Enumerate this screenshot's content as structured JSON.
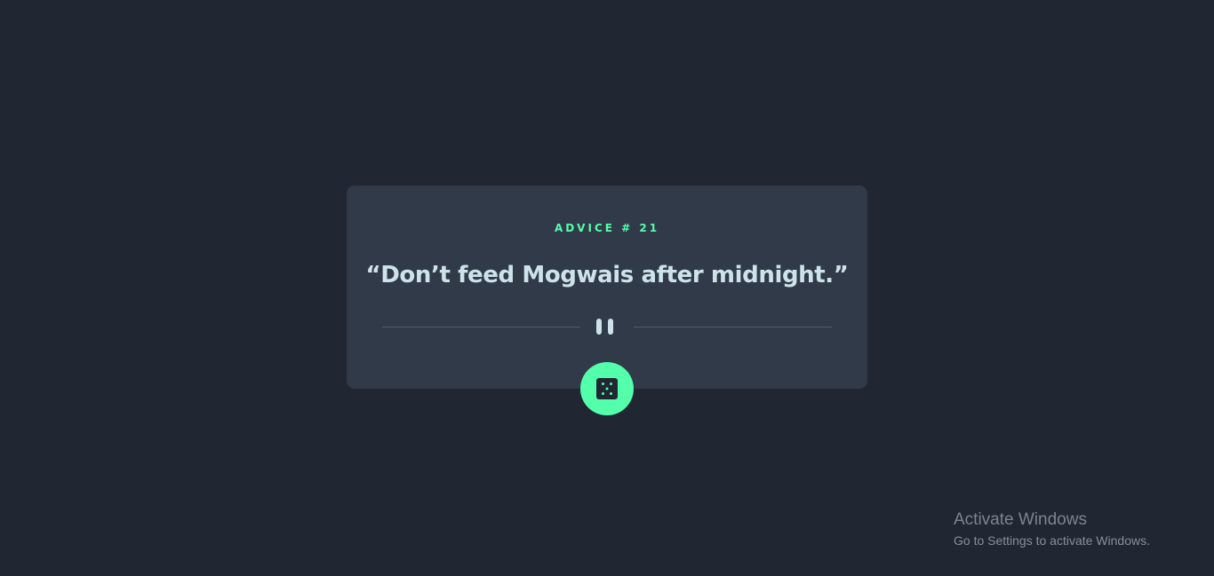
{
  "card": {
    "advice_label": "ADVICE # 21",
    "advice_text": "“Don’t feed Mogwais after midnight.”"
  },
  "divider": {
    "icon": "pause-icon"
  },
  "button": {
    "icon": "dice-icon",
    "accent_color": "#53FFAB"
  },
  "watermark": {
    "title": "Activate Windows",
    "subtitle": "Go to Settings to activate Windows."
  },
  "colors": {
    "background": "#202632",
    "card": "#313A48",
    "accent": "#53FFAB",
    "text": "#CEE3E9",
    "divider": "#4F5D74"
  }
}
